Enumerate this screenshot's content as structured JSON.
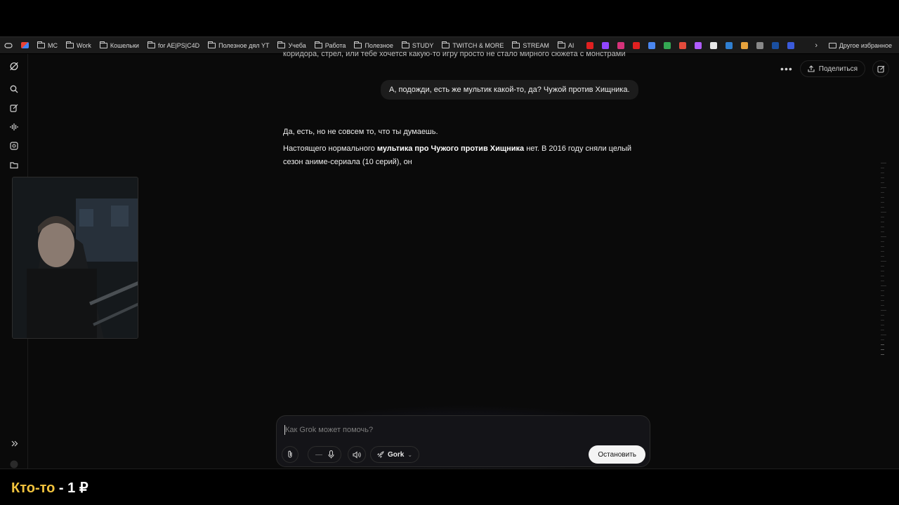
{
  "bookmarks": {
    "items": [
      {
        "label": "MC",
        "type": "folder"
      },
      {
        "label": "Work",
        "type": "folder"
      },
      {
        "label": "Кошельки",
        "type": "folder"
      },
      {
        "label": "for AE|PS|C4D",
        "type": "folder"
      },
      {
        "label": "Полезное дял YT",
        "type": "folder"
      },
      {
        "label": "Учеба",
        "type": "folder"
      },
      {
        "label": "Работа",
        "type": "folder"
      },
      {
        "label": "Полезное",
        "type": "folder"
      },
      {
        "label": "STUDY",
        "type": "folder"
      },
      {
        "label": "TWITCH & MORE",
        "type": "folder"
      },
      {
        "label": "STREAM",
        "type": "folder"
      },
      {
        "label": "AI",
        "type": "folder"
      }
    ],
    "favicons": [
      {
        "icon": "youtube-icon",
        "color": "#e02020"
      },
      {
        "icon": "twitch-icon",
        "color": "#9146ff"
      },
      {
        "icon": "instagram-icon",
        "color": "#d6327a"
      },
      {
        "icon": "youtube-icon",
        "color": "#e02020"
      },
      {
        "icon": "translate-icon",
        "color": "#4a86f0"
      },
      {
        "icon": "maps-icon",
        "color": "#34a853"
      },
      {
        "icon": "location-icon",
        "color": "#e44b3c"
      },
      {
        "icon": "twitch-icon",
        "color": "#b05cff"
      },
      {
        "icon": "notion-icon",
        "color": "#e8e8e8"
      },
      {
        "icon": "im-icon",
        "color": "#2f7fd1"
      },
      {
        "icon": "folder-icon",
        "color": "#e6a23c"
      },
      {
        "icon": "re-icon",
        "color": "#888888"
      },
      {
        "icon": "excel-icon",
        "color": "#1a4fa0"
      },
      {
        "icon": "x-icon",
        "color": "#3b5bdb"
      }
    ],
    "other_label": "Другое избранное"
  },
  "header": {
    "more_label": "•••",
    "share_label": "Поделиться"
  },
  "chat": {
    "cut_line": "коридора, стрел, или тебе хочется какую-то игру просто не стало мирного сюжета с монстрами",
    "user_message": "А, подожди, есть же мультик какой-то, да? Чужой против Хищника.",
    "reply_p1": "Да, есть, но не совсем то, что ты думаешь.",
    "reply_p2_before": "Настоящего нормального ",
    "reply_p2_bold": "мультика про Чужого против Хищника",
    "reply_p2_after": " нет. В 2016 году сняли целый сезон аниме-сериала (10 серий), он"
  },
  "composer": {
    "placeholder": "Как Grok может помочь?",
    "model_label": "Gork",
    "stop_label": "Остановить"
  },
  "overlay": {
    "donor_name": "Кто-то",
    "separator": " - ",
    "amount": "1 ₽"
  }
}
